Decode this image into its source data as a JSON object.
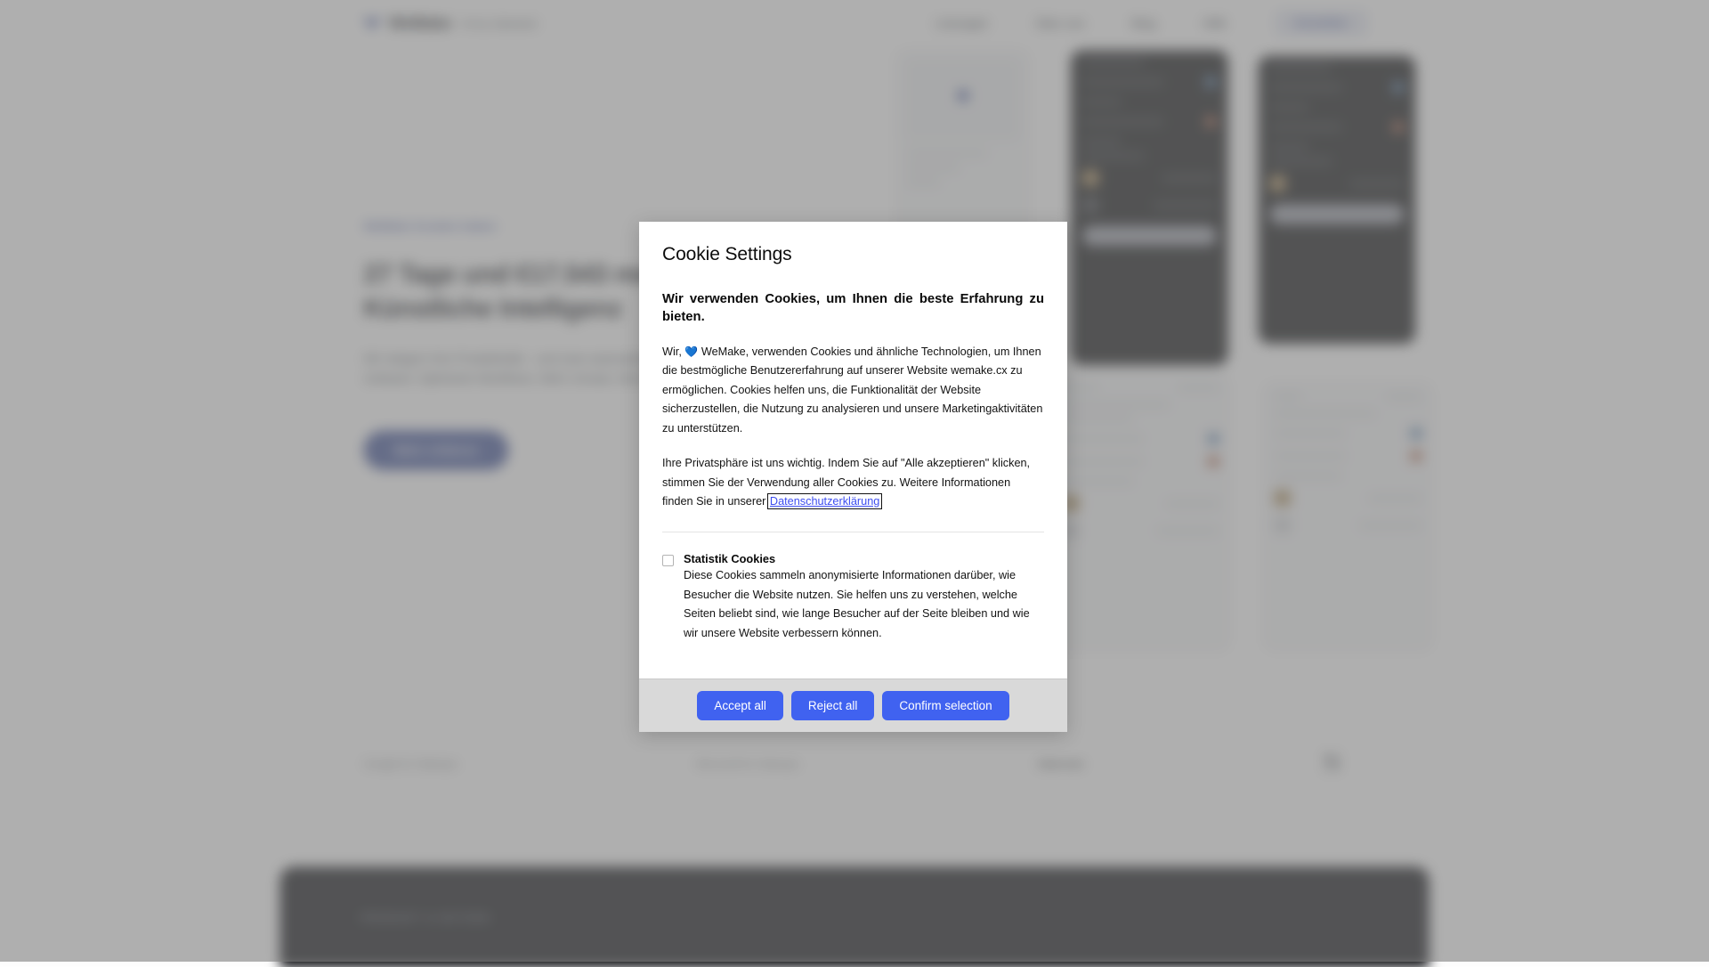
{
  "page": {
    "nav": {
      "brand_name": "WeMake",
      "brand_sub": "AI by Salesbot",
      "links": [
        {
          "label": "Lösungen"
        },
        {
          "label": "Über uns"
        },
        {
          "label": "Blog"
        },
        {
          "label": "Hilfe"
        }
      ],
      "cta_label": "Anmelden"
    },
    "hero": {
      "eyebrow": "WeMake Kunden haben",
      "title": "27 Tage und €17.543 mehr im Jahr durch Künstliche Intelligenz",
      "subtitle": "Wir steigern Ihre Produktivität – und zwar automatisiert, rund um die Uhr. Weniger Aufwand. Optimierte Workflows. Mehr Umsatz. Bereit für den nächsten Schritt?",
      "cta_label": "Mehr erfahren"
    },
    "logos": [
      {
        "label": "Google for Startups",
        "style": "normal"
      },
      {
        "label": "Microsoft for Startups",
        "style": "normal"
      },
      {
        "label": "Intercom",
        "style": "bold"
      },
      {
        "label": "N",
        "style": "mark"
      }
    ],
    "dark_section": {
      "eyebrow": "PRODUKT & NUTZEN"
    }
  },
  "modal": {
    "title": "Cookie Settings",
    "heading": "Wir verwenden Cookies, um Ihnen die beste Erfahrung zu bieten.",
    "paragraph_1_before_heart": "Wir, ",
    "heart_icon": "💙",
    "paragraph_1_after_heart": " WeMake, verwenden Cookies und ähnliche Technologien, um Ihnen die bestmögliche Benutzererfahrung auf unserer Website wemake.cx zu ermöglichen. Cookies helfen uns, die Funktionalität der Website sicherzustellen, die Nutzung zu analysieren und unsere Marketingaktivitäten zu unterstützen.",
    "paragraph_2_before_link": "Ihre Privatsphäre ist uns wichtig. Indem Sie auf \"Alle akzeptieren\" klicken, stimmen Sie der Verwendung aller Cookies zu. Weitere Informationen finden Sie in unserer ",
    "privacy_link_label": "Datenschutzerklärung",
    "cookie_option": {
      "name": "Statistik Cookies",
      "checked": false,
      "description": "Diese Cookies sammeln anonymisierte Informationen darüber, wie Besucher die Website nutzen. Sie helfen uns zu verstehen, welche Seiten beliebt sind, wie lange Besucher auf der Seite bleiben und wie wir unsere Website verbessern können."
    },
    "buttons": {
      "accept_all": "Accept all",
      "reject_all": "Reject all",
      "confirm_selection": "Confirm selection"
    },
    "colors": {
      "button_blue": "#4062f0",
      "link_blue": "#3c4df0",
      "footer_bg": "#d9d9d9"
    }
  }
}
